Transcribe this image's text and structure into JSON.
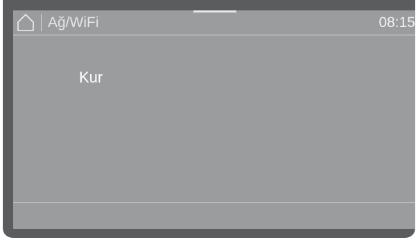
{
  "header": {
    "home_icon": "home-icon",
    "title": "Ağ/WiFi",
    "time": "08:15"
  },
  "menu": {
    "items": [
      {
        "label": "Kur"
      }
    ]
  },
  "colors": {
    "frame": "#5b5c5f",
    "screen": "#9b9c9e",
    "text": "#ffffff"
  }
}
